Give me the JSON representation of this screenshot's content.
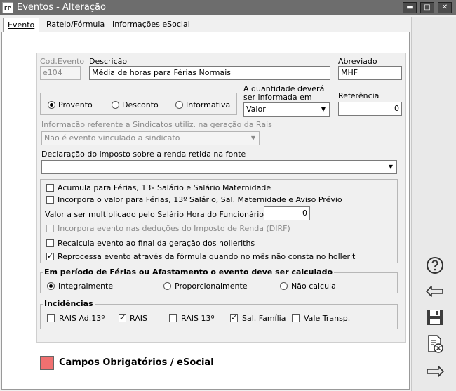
{
  "window": {
    "title": "Eventos - Alteração",
    "app_icon": "FP",
    "minimize": "▬",
    "maximize": "□",
    "close": "✕"
  },
  "tabs": [
    {
      "label": "Evento",
      "active": true
    },
    {
      "label": "Rateio/Fórmula",
      "active": false
    },
    {
      "label": "Informações eSocial",
      "active": false
    }
  ],
  "fields": {
    "cod_evento": {
      "label": "Cod.Evento",
      "value": "e104"
    },
    "descricao": {
      "label": "Descrição",
      "value": "Média de horas para Férias Normais"
    },
    "abreviado": {
      "label": "Abreviado",
      "value": "MHF"
    },
    "quantidade": {
      "label_line1": "A quantidade deverá",
      "label_line2": "ser informada em",
      "value": "Valor"
    },
    "referencia": {
      "label": "Referência",
      "value": "0"
    },
    "sindicatos": {
      "label": "Informação referente a Sindicatos utiliz. na geração da Rais",
      "value": "Não é evento vinculado a sindicato"
    },
    "declaracao": {
      "label": "Declaração do imposto sobre a renda retida na fonte",
      "value": ""
    },
    "valor_multiplicado": {
      "label": "Valor a ser multiplicado pelo Salário Hora do Funcionário",
      "value": "0"
    }
  },
  "tipo": {
    "options": [
      "Provento",
      "Desconto",
      "Informativa"
    ],
    "selected": "Provento"
  },
  "checks": [
    {
      "label": "Acumula para Férias, 13º Salário e Salário Maternidade",
      "checked": false,
      "disabled": false
    },
    {
      "label": "Incorpora o valor para Férias, 13º Salário, Sal. Maternidade e Aviso Prévio",
      "checked": false,
      "disabled": false
    },
    {
      "label": "Incorpora evento nas deduções do Imposto de Renda (DIRF)",
      "checked": false,
      "disabled": true
    },
    {
      "label": "Recalcula evento ao final da geração dos holleriths",
      "checked": false,
      "disabled": false
    },
    {
      "label": "Reprocessa evento através da fórmula quando no mês não consta no hollerit",
      "checked": true,
      "disabled": false
    }
  ],
  "periodo": {
    "title": "Em período de Férias ou Afastamento o evento deve ser calculado",
    "options": [
      "Integralmente",
      "Proporcionalmente",
      "Não calcula"
    ],
    "selected": "Integralmente"
  },
  "incidencias": {
    "title": "Incidências",
    "items": [
      {
        "label": "RAIS Ad.13º",
        "checked": false
      },
      {
        "label": "RAIS",
        "checked": true
      },
      {
        "label": "RAIS 13º",
        "checked": false
      },
      {
        "label": "Sal. Família",
        "checked": true
      },
      {
        "label": "Vale Transp.",
        "checked": false
      }
    ]
  },
  "required_legend": "Campos Obrigatórios / eSocial",
  "side_icons": [
    "help-icon",
    "back-arrow-icon",
    "save-icon",
    "cancel-document-icon",
    "forward-arrow-icon"
  ],
  "colors": {
    "titlebar": "#6d6d6d",
    "required": "#f07070"
  }
}
